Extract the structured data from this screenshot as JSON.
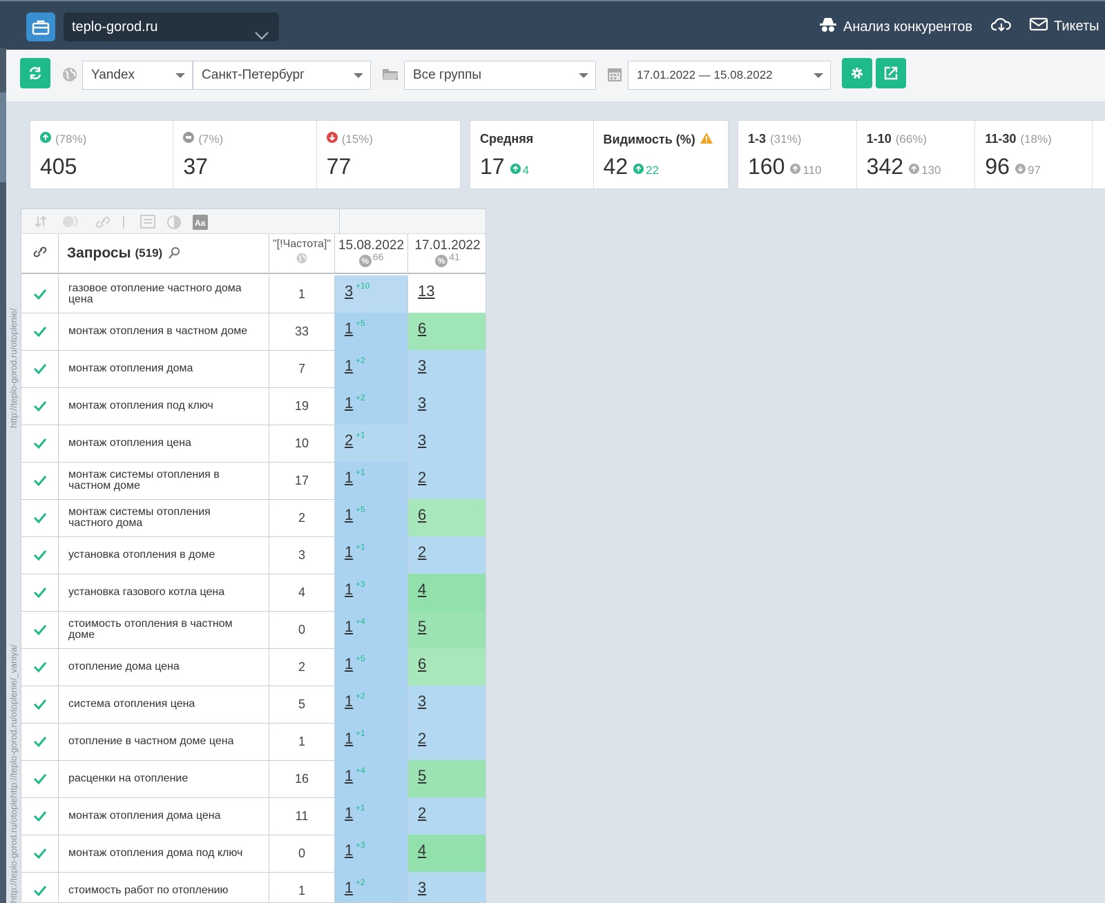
{
  "header": {
    "site": "teplo-gorod.ru",
    "competitors_link": "Анализ конкурентов",
    "tickets_link": "Тикеты"
  },
  "toolbar": {
    "engine": "Yandex",
    "region": "Санкт-Петербург",
    "group": "Все группы",
    "date_range": "17.01.2022 — 15.08.2022"
  },
  "stats": {
    "up": {
      "pct": "(78%)",
      "value": "405"
    },
    "same": {
      "pct": "(7%)",
      "value": "37"
    },
    "down": {
      "pct": "(15%)",
      "value": "77"
    },
    "average": {
      "label": "Средняя",
      "value": "17",
      "delta": "4"
    },
    "visibility": {
      "label": "Видимость (%)",
      "value": "42",
      "delta": "22"
    },
    "top3": {
      "label": "1-3",
      "pct": "(31%)",
      "value": "160",
      "delta": "110"
    },
    "top10": {
      "label": "1-10",
      "pct": "(66%)",
      "value": "342",
      "delta": "130"
    },
    "top30": {
      "label": "11-30",
      "pct": "(18%)",
      "value": "96",
      "delta": "97"
    }
  },
  "table": {
    "title": "Запросы",
    "count": "(519)",
    "freq_header": "\"[!Частота]\"",
    "date1": "15.08.2022",
    "date1_pct": "66",
    "date2": "17.01.2022",
    "date2_pct": "41",
    "vertical_label_1": "http://teplo-gorod.ru/otoplenie/",
    "vertical_label_2": "http://teplo-gorod.ru/otoplehttp://teplo-gorod.ru/otoplenie/_vaniya/",
    "rows": [
      {
        "query": "газовое отопление частного дома цена",
        "freq": "1",
        "pos1": "3",
        "delta": "+10",
        "pos2": "13",
        "c1": "#b9daf2",
        "c2": "#ffffff"
      },
      {
        "query": "монтаж отопления в частном доме",
        "freq": "33",
        "pos1": "1",
        "delta": "+5",
        "pos2": "6",
        "c1": "#a9d3f1",
        "c2": "#9fe5b7"
      },
      {
        "query": "монтаж отопления дома",
        "freq": "7",
        "pos1": "1",
        "delta": "+2",
        "pos2": "3",
        "c1": "#a9d3f1",
        "c2": "#b3d8f2"
      },
      {
        "query": "монтаж отопления под ключ",
        "freq": "19",
        "pos1": "1",
        "delta": "+2",
        "pos2": "3",
        "c1": "#a9d3f1",
        "c2": "#b3d8f2"
      },
      {
        "query": "монтаж отопления цена",
        "freq": "10",
        "pos1": "2",
        "delta": "+1",
        "pos2": "3",
        "c1": "#b3d8f2",
        "c2": "#b3d8f2"
      },
      {
        "query": "монтаж системы отопления в частном доме",
        "freq": "17",
        "pos1": "1",
        "delta": "+1",
        "pos2": "2",
        "c1": "#a9d3f1",
        "c2": "#b3d8f2"
      },
      {
        "query": "монтаж системы отопления частного дома",
        "freq": "2",
        "pos1": "1",
        "delta": "+5",
        "pos2": "6",
        "c1": "#a9d3f1",
        "c2": "#a8e6bc"
      },
      {
        "query": "установка отопления в доме",
        "freq": "3",
        "pos1": "1",
        "delta": "+1",
        "pos2": "2",
        "c1": "#a9d3f1",
        "c2": "#b3d8f2"
      },
      {
        "query": "установка газового котла цена",
        "freq": "4",
        "pos1": "1",
        "delta": "+3",
        "pos2": "4",
        "c1": "#a9d3f1",
        "c2": "#92e0ab"
      },
      {
        "query": "стоимость отопления в частном доме",
        "freq": "0",
        "pos1": "1",
        "delta": "+4",
        "pos2": "5",
        "c1": "#a9d3f1",
        "c2": "#9be3b2"
      },
      {
        "query": "отопление дома цена",
        "freq": "2",
        "pos1": "1",
        "delta": "+5",
        "pos2": "6",
        "c1": "#a9d3f1",
        "c2": "#a8e6bc"
      },
      {
        "query": "система отопления цена",
        "freq": "5",
        "pos1": "1",
        "delta": "+2",
        "pos2": "3",
        "c1": "#a9d3f1",
        "c2": "#b3d8f2"
      },
      {
        "query": "отопление в частном доме цена",
        "freq": "1",
        "pos1": "1",
        "delta": "+1",
        "pos2": "2",
        "c1": "#a9d3f1",
        "c2": "#b3d8f2"
      },
      {
        "query": "расценки на отопление",
        "freq": "16",
        "pos1": "1",
        "delta": "+4",
        "pos2": "5",
        "c1": "#a9d3f1",
        "c2": "#9be3b2"
      },
      {
        "query": "монтаж отопления дома цена",
        "freq": "11",
        "pos1": "1",
        "delta": "+1",
        "pos2": "2",
        "c1": "#a9d3f1",
        "c2": "#b3d8f2"
      },
      {
        "query": "монтаж отопления дома под ключ",
        "freq": "0",
        "pos1": "1",
        "delta": "+3",
        "pos2": "4",
        "c1": "#a9d3f1",
        "c2": "#92e0ab"
      },
      {
        "query": "стоимость работ по отоплению",
        "freq": "1",
        "pos1": "1",
        "delta": "+2",
        "pos2": "3",
        "c1": "#a9d3f1",
        "c2": "#b3d8f2"
      }
    ]
  }
}
